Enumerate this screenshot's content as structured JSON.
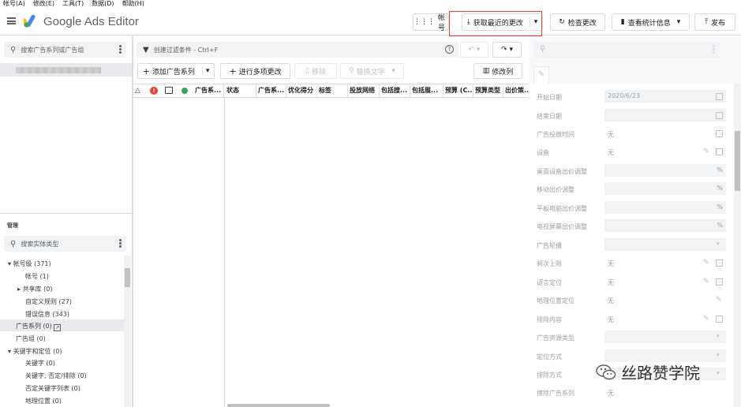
{
  "menu": [
    "帐号(A)",
    "修改(E)",
    "工具(T)",
    "数据(D)",
    "帮助(H)"
  ],
  "app": {
    "title": "Google Ads Editor"
  },
  "toolbar": {
    "account": "帐号",
    "get_changes": "获取最近的更改",
    "check_changes": "检查更改",
    "view_stats": "查看统计信息",
    "publish": "发布"
  },
  "left": {
    "search_placeholder": "搜索广告系列或广告组",
    "manage_label": "管理",
    "entity_search_placeholder": "搜索实体类型",
    "tree": [
      {
        "label": "帐号级 (371)",
        "arrow": "▾"
      },
      {
        "label": "帐号 (1)"
      },
      {
        "label": "共享库 (0)",
        "arrow": "▸"
      },
      {
        "label": "自定义规则 (27)"
      },
      {
        "label": "错误信息 (343)"
      },
      {
        "label": "广告系列 (0)"
      },
      {
        "label": "广告组 (0)"
      },
      {
        "label": "关键字和定位 (0)",
        "arrow": "▾"
      },
      {
        "label": "关键字 (0)"
      },
      {
        "label": "关键字, 否定/排除 (0)"
      },
      {
        "label": "否定关键字列表 (0)"
      },
      {
        "label": "地理位置 (0)"
      }
    ]
  },
  "middle": {
    "filter_placeholder": "创建过滤条件 - Ctrl+F",
    "add_campaign": "添加广告系列",
    "multi_edit": "进行多项更改",
    "remove": "移除",
    "replace_text": "替换文字",
    "edit_columns": "修改列",
    "columns": [
      "广告系...",
      "状态",
      "广告系...",
      "优化得分",
      "标签",
      "投放网络",
      "包括搜...",
      "包括展...",
      "预算 (C...",
      "预算类型",
      "出价策..."
    ]
  },
  "right": {
    "fields": [
      {
        "label": "开始日期",
        "value": "2020/6/23"
      },
      {
        "label": "结束日期",
        "value": ""
      },
      {
        "label": "广告投放时间",
        "value": "无"
      },
      {
        "label": "设备",
        "value": "无"
      },
      {
        "label": "桌面设备出价调整",
        "value": "%"
      },
      {
        "label": "移动出价调整",
        "value": "%"
      },
      {
        "label": "平板电脑出价调整",
        "value": "%"
      },
      {
        "label": "电视屏幕出价调整",
        "value": "%"
      },
      {
        "label": "广告轮播",
        "value": ""
      },
      {
        "label": "频次上限",
        "value": "无"
      },
      {
        "label": "语言定位",
        "value": "无"
      },
      {
        "label": "地理位置定位",
        "value": "无"
      },
      {
        "label": "排除内容",
        "value": "无"
      },
      {
        "label": "广告资源类型",
        "value": ""
      },
      {
        "label": "定位方式",
        "value": ""
      },
      {
        "label": "排除方式",
        "value": ""
      },
      {
        "label": "擦除广告系列",
        "value": "无"
      }
    ]
  },
  "watermark": "丝路赞学院",
  "colors": {
    "accent_red": "#ea4335",
    "accent_green": "#34a853",
    "google_blue": "#4285f4",
    "google_yellow": "#fbbc04"
  }
}
